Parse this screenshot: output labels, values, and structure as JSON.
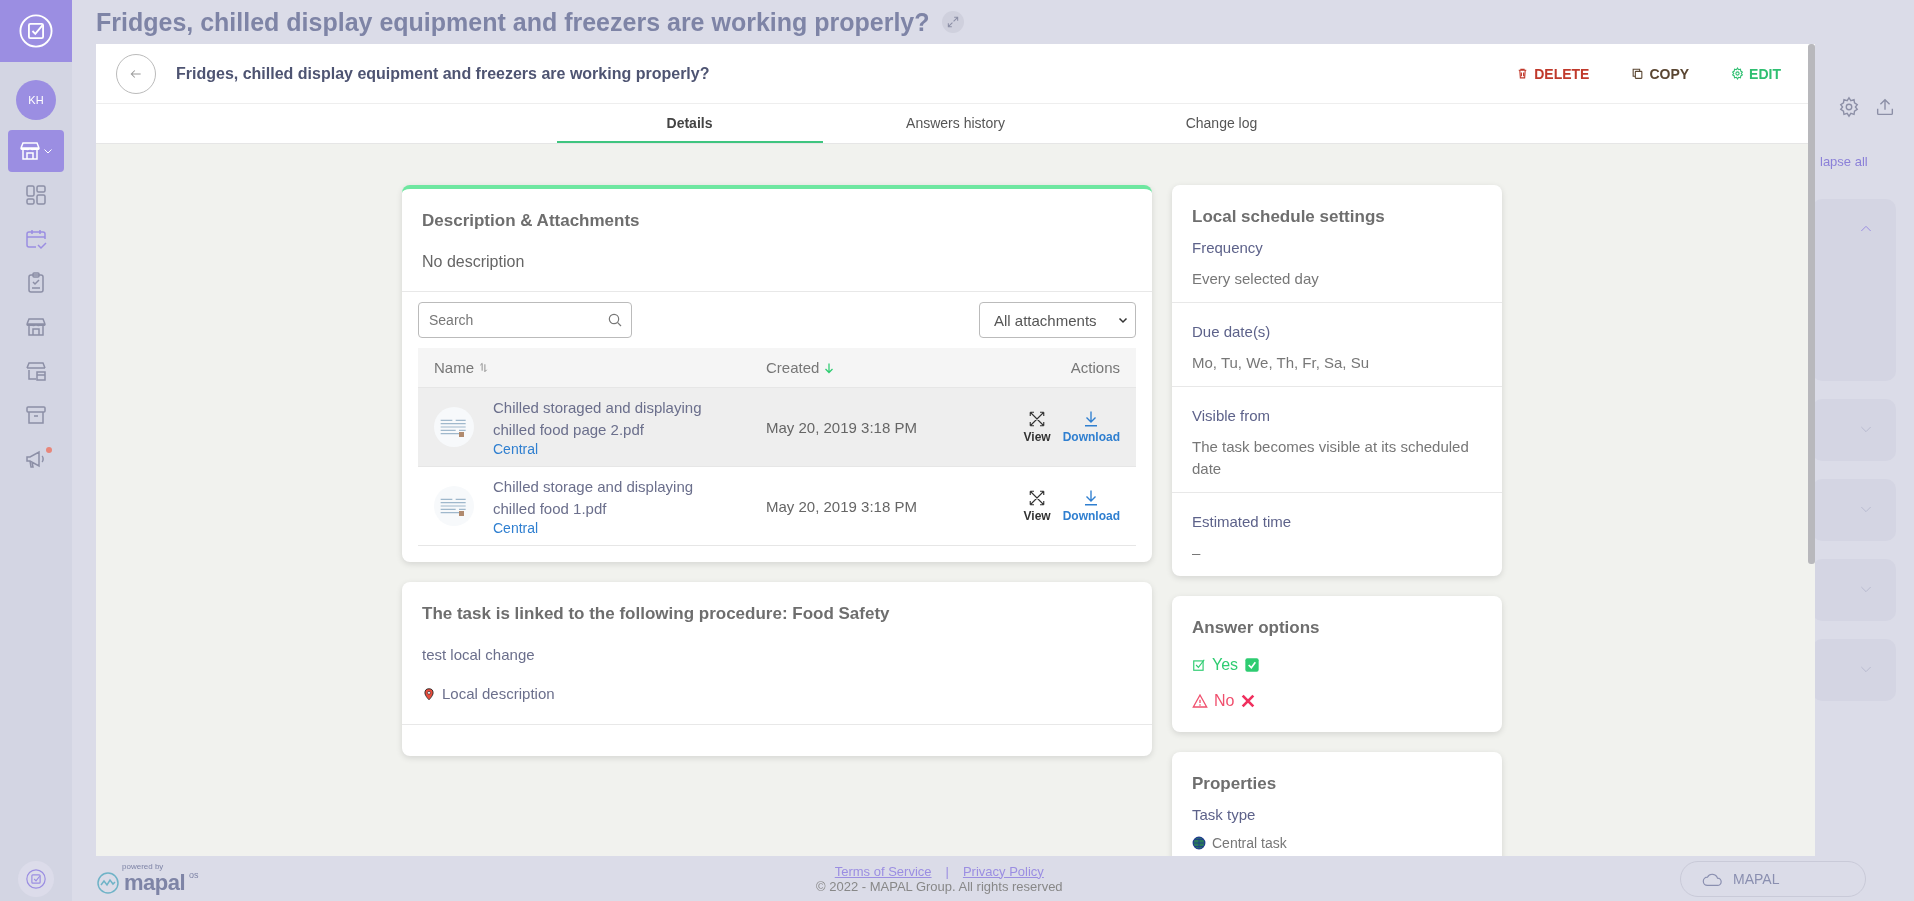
{
  "sidebar": {
    "avatar": "KH",
    "items": [
      {
        "kind": "store",
        "selected": true,
        "highlighted": false,
        "badge": false
      },
      {
        "kind": "dashboard",
        "selected": false,
        "highlighted": false,
        "badge": false
      },
      {
        "kind": "calendar",
        "selected": false,
        "highlighted": true,
        "badge": false
      },
      {
        "kind": "clipboard",
        "selected": false,
        "highlighted": false,
        "badge": false
      },
      {
        "kind": "store",
        "selected": false,
        "highlighted": false,
        "badge": false
      },
      {
        "kind": "store-settings",
        "selected": false,
        "highlighted": false,
        "badge": false
      },
      {
        "kind": "archive",
        "selected": false,
        "highlighted": false,
        "badge": false
      },
      {
        "kind": "megaphone",
        "selected": false,
        "highlighted": false,
        "badge": true
      }
    ]
  },
  "page_title": "Fridges, chilled display equipment and freezers are working properly?",
  "background": {
    "collapse_link": "lapse all",
    "panels": [
      {
        "expanded": true
      },
      {
        "expanded": false
      },
      {
        "expanded": false
      },
      {
        "expanded": false
      },
      {
        "expanded": false
      }
    ]
  },
  "modal": {
    "title": "Fridges, chilled display equipment and freezers are working properly?",
    "actions": [
      {
        "kind": "delete",
        "label": "DELETE"
      },
      {
        "kind": "copy",
        "label": "COPY"
      },
      {
        "kind": "edit",
        "label": "EDIT"
      }
    ],
    "tabs": [
      {
        "label": "Details",
        "selected": true
      },
      {
        "label": "Answers history",
        "selected": false
      },
      {
        "label": "Change log",
        "selected": false
      }
    ],
    "description_card": {
      "title": "Description & Attachments",
      "description": "No description",
      "search": {
        "placeholder": "Search"
      },
      "filter": "All attachments",
      "columns": [
        {
          "label": "Name",
          "kind": "sortable"
        },
        {
          "label": "Created",
          "kind": "sorted"
        },
        {
          "label": "Actions",
          "kind": "plain"
        }
      ],
      "rows": [
        {
          "name": "Chilled storaged and displaying chilled food page 2.pdf",
          "source": "Central",
          "created": "May 20, 2019 3:18 PM",
          "highlighted": true,
          "actions": [
            {
              "kind": "view",
              "label": "View"
            },
            {
              "kind": "download",
              "label": "Download"
            }
          ]
        },
        {
          "name": "Chilled storage and displaying chilled food 1.pdf",
          "source": "Central",
          "created": "May 20, 2019 3:18 PM",
          "highlighted": false,
          "actions": [
            {
              "kind": "view",
              "label": "View"
            },
            {
              "kind": "download",
              "label": "Download"
            }
          ]
        }
      ]
    },
    "procedure_card": {
      "title": "The task is linked to the following procedure: Food Safety",
      "text": "test local change",
      "location": "Local description"
    },
    "schedule_card": {
      "title": "Local schedule settings",
      "fields": [
        {
          "label": "Frequency",
          "value": "Every selected day"
        },
        {
          "label": "Due date(s)",
          "value": "Mo, Tu, We, Th, Fr, Sa, Su"
        },
        {
          "label": "Visible from",
          "value": "The task becomes visible at its scheduled date"
        },
        {
          "label": "Estimated time",
          "value": "–"
        }
      ]
    },
    "answers_card": {
      "title": "Answer options",
      "options": [
        {
          "kind": "yes",
          "label": "Yes"
        },
        {
          "kind": "no",
          "label": "No"
        }
      ]
    },
    "properties_card": {
      "title": "Properties",
      "fields": [
        {
          "label": "Task type",
          "value": "Central task",
          "kind": "central"
        }
      ]
    }
  },
  "footer": {
    "powered_by": "powered by",
    "brand": "mapal",
    "brand_suffix": "os",
    "links": [
      "Terms of Service",
      "Privacy Policy"
    ],
    "separator": "|",
    "copyright": "© 2022 - MAPAL Group. All rights reserved",
    "cloud_button": "MAPAL"
  }
}
